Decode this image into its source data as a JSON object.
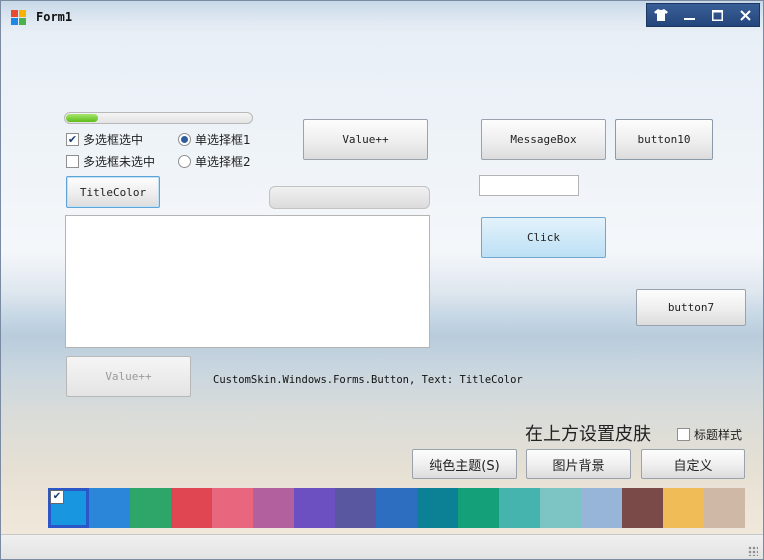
{
  "window": {
    "title": "Form1"
  },
  "titlebar_buttons": [
    "skin-icon",
    "minimize-icon",
    "maximize-icon",
    "close-icon"
  ],
  "progress_top": 0.17,
  "progress_mid": 0,
  "checkboxes": [
    {
      "label": "多选框选中",
      "checked": true
    },
    {
      "label": "多选框未选中",
      "checked": false
    }
  ],
  "radios": [
    {
      "label": "单选择框1",
      "checked": true
    },
    {
      "label": "单选择框2",
      "checked": false
    }
  ],
  "buttons": {
    "title_color": "TitleColor",
    "value_pp_top": "Value++",
    "value_pp_disabled": "Value++",
    "message_box": "MessageBox",
    "button10": "button10",
    "click": "Click",
    "button7": "button7",
    "pure_theme": "纯色主题(S)",
    "image_bg": "图片背景",
    "custom": "自定义"
  },
  "inputs": {
    "small_textbox": "",
    "multiline_textbox": ""
  },
  "info_text": "CustomSkin.Windows.Forms.Button, Text: TitleColor",
  "skin_label": "在上方设置皮肤",
  "title_style_checkbox": {
    "label": "标题样式",
    "checked": false
  },
  "palette": {
    "selected_index": 0,
    "colors": [
      "#1996e0",
      "#2b86d9",
      "#2ea66a",
      "#e04552",
      "#e8667e",
      "#b2609e",
      "#6c4fc0",
      "#58579f",
      "#2e6ec0",
      "#0c8196",
      "#14a079",
      "#45b3ae",
      "#7cc5c4",
      "#97b5d8",
      "#7a4a48",
      "#efbc58",
      "#cfb8a6"
    ]
  }
}
